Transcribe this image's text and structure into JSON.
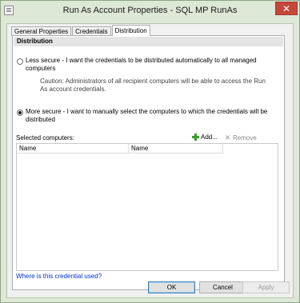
{
  "window": {
    "title": "Run As Account Properties - SQL MP RunAs",
    "close_glyph": "✕"
  },
  "tabs": [
    {
      "label": "General Properties"
    },
    {
      "label": "Credentials"
    },
    {
      "label": "Distribution"
    }
  ],
  "distribution": {
    "header": "Distribution",
    "less_secure": {
      "line1": "Less secure - I want the credentials to be distributed automatically to all managed",
      "line2": "computers",
      "caution1": "Caution: Administrators of all recipient computers will be able to access the Run",
      "caution2": "As account credentials.",
      "checked": false
    },
    "more_secure": {
      "line1": "More secure - I want to manually select the computers to which the credentials will be",
      "line2": "distributed",
      "checked": true
    },
    "selected_label": "Selected computers:",
    "add_label": "Add...",
    "remove_label": "Remove",
    "columns": [
      "Name",
      "Name"
    ],
    "link": "Where is this credential used?"
  },
  "buttons": {
    "ok": "OK",
    "cancel": "Cancel",
    "apply": "Apply"
  }
}
